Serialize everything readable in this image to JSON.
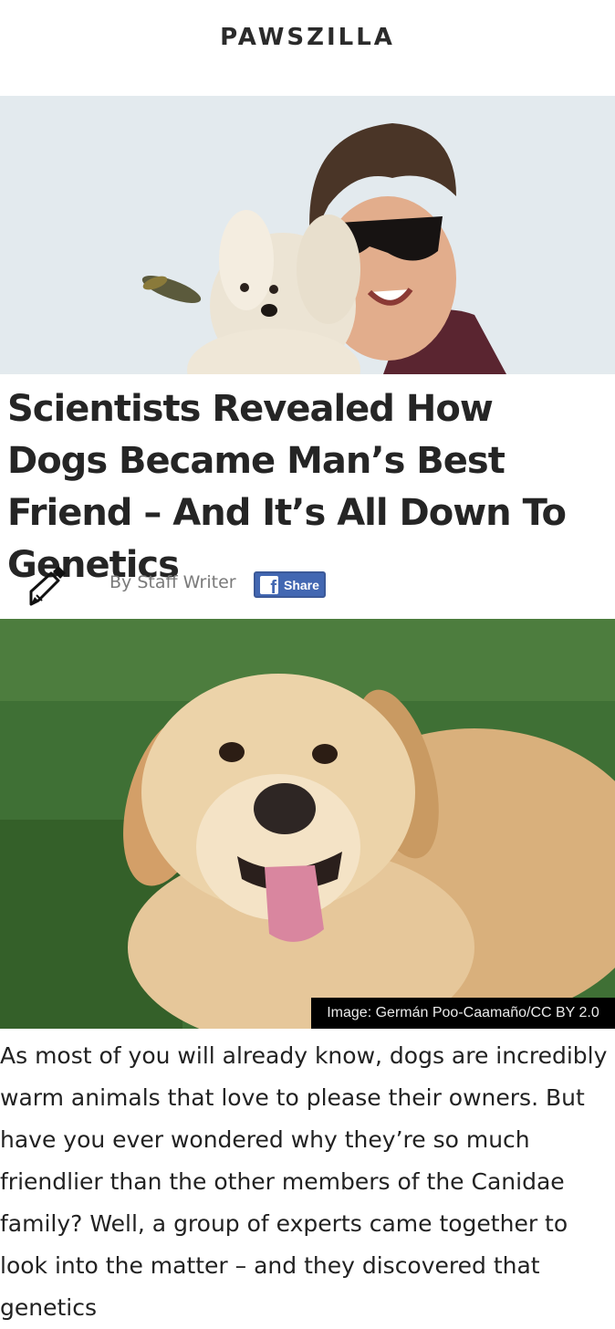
{
  "site": {
    "logo": "PAWSZILLA"
  },
  "article": {
    "title": "Scientists Revealed How Dogs Became Man’s Best Friend – And It’s All Down To Genetics",
    "author": "By Staff Writer",
    "share_label": "Share",
    "image_credit": "Image: Germán Poo-Caamaño/CC BY 2.0",
    "body": "As most of you will already know, dogs are incredibly warm animals that love to please their owners. But have you ever wondered why they’re so much friendlier than the other members of the Canidae family? Well, a group of experts came together to look into the matter – and they discovered that genetics"
  },
  "icons": {
    "author": "pen-icon",
    "share": "facebook-icon"
  },
  "colors": {
    "facebook": "#4267b2",
    "caption_bg": "#000000",
    "logo": "#2b2b2b"
  }
}
